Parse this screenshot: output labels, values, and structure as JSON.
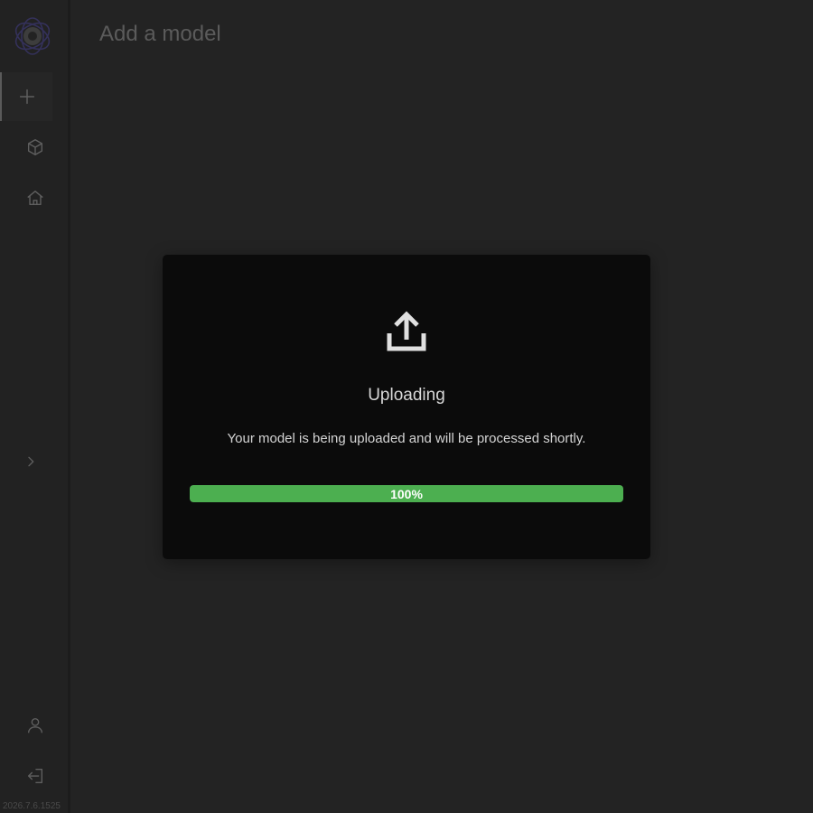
{
  "app": {
    "version": "2026.7.6.1525"
  },
  "header": {
    "title": "Add a model"
  },
  "sidebar": {
    "logo_icon": "app-logo-icon",
    "items": [
      {
        "icon": "plus-icon",
        "active": true
      },
      {
        "icon": "cube-icon",
        "active": false
      },
      {
        "icon": "home-icon",
        "active": false
      }
    ],
    "expand_icon": "chevron-right-icon",
    "bottom_items": [
      {
        "icon": "user-icon"
      },
      {
        "icon": "logout-icon"
      }
    ]
  },
  "modal": {
    "icon": "upload-icon",
    "title": "Uploading",
    "message": "Your model is being uploaded and will be processed shortly.",
    "progress": {
      "value": 100,
      "label": "100%"
    }
  },
  "colors": {
    "background": "#232323",
    "sidebar": "#222222",
    "modal": "#0b0b0b",
    "progress_fill": "#4caf50",
    "logo_accent": "#3b3863"
  }
}
